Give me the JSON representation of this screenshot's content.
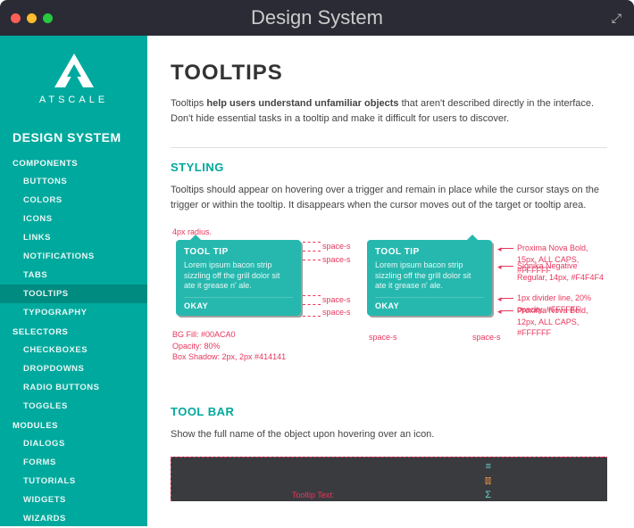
{
  "window": {
    "title": "Design System"
  },
  "brand": {
    "name": "ATSCALE"
  },
  "sidebar": {
    "header": "DESIGN SYSTEM",
    "sections": [
      {
        "label": "COMPONENTS",
        "items": [
          "BUTTONS",
          "COLORS",
          "ICONS",
          "LINKS",
          "NOTIFICATIONS",
          "TABS",
          "TOOLTIPS",
          "TYPOGRAPHY"
        ],
        "activeIndex": 6
      },
      {
        "label": "SELECTORS",
        "items": [
          "CHECKBOXES",
          "DROPDOWNS",
          "RADIO BUTTONS",
          "TOGGLES"
        ]
      },
      {
        "label": "MODULES",
        "items": [
          "DIALOGS",
          "FORMS",
          "TUTORIALS",
          "WIDGETS",
          "WIZARDS"
        ]
      }
    ]
  },
  "page": {
    "title": "TOOLTIPS",
    "intro_prefix": "Tooltips ",
    "intro_bold": "help users understand unfamiliar objects",
    "intro_suffix": " that aren't described directly in the interface. Don't hide essential tasks in a tooltip and make it difficult for users to discover."
  },
  "styling": {
    "title": "STYLING",
    "body": "Tooltips should appear on hovering over a trigger and remain in place while the cursor stays on the trigger or within the tooltip. It disappears when the cursor moves out of the target or tooltip area.",
    "annotations": {
      "radius": "4px radius.",
      "space_s": "space-s",
      "bg_line1": "BG Fill: #00ACA0",
      "bg_line2": "Opacity: 80%",
      "bg_line3": "Box Shadow: 2px, 2px #414141",
      "font_title": "Proxima Nova Bold, 15px, ALL CAPS, #FFFFFF",
      "font_body": "Signika Negative Regular, 14px, #F4F4F4",
      "divider": "1px divider line, 20% opacity, #FFFFFF",
      "font_action": "Proxima Nova Bold, 12px, ALL CAPS, #FFFFFF"
    },
    "tooltip": {
      "title": "TOOL TIP",
      "body": "Lorem ipsum bacon strip sizzling off the grill dolor sit ate it grease n' ale.",
      "action": "OKAY"
    }
  },
  "toolbar": {
    "title": "TOOL BAR",
    "body": "Show the full name of the object upon hovering over an icon.",
    "tooltip_label": "Tooltip Text:"
  }
}
